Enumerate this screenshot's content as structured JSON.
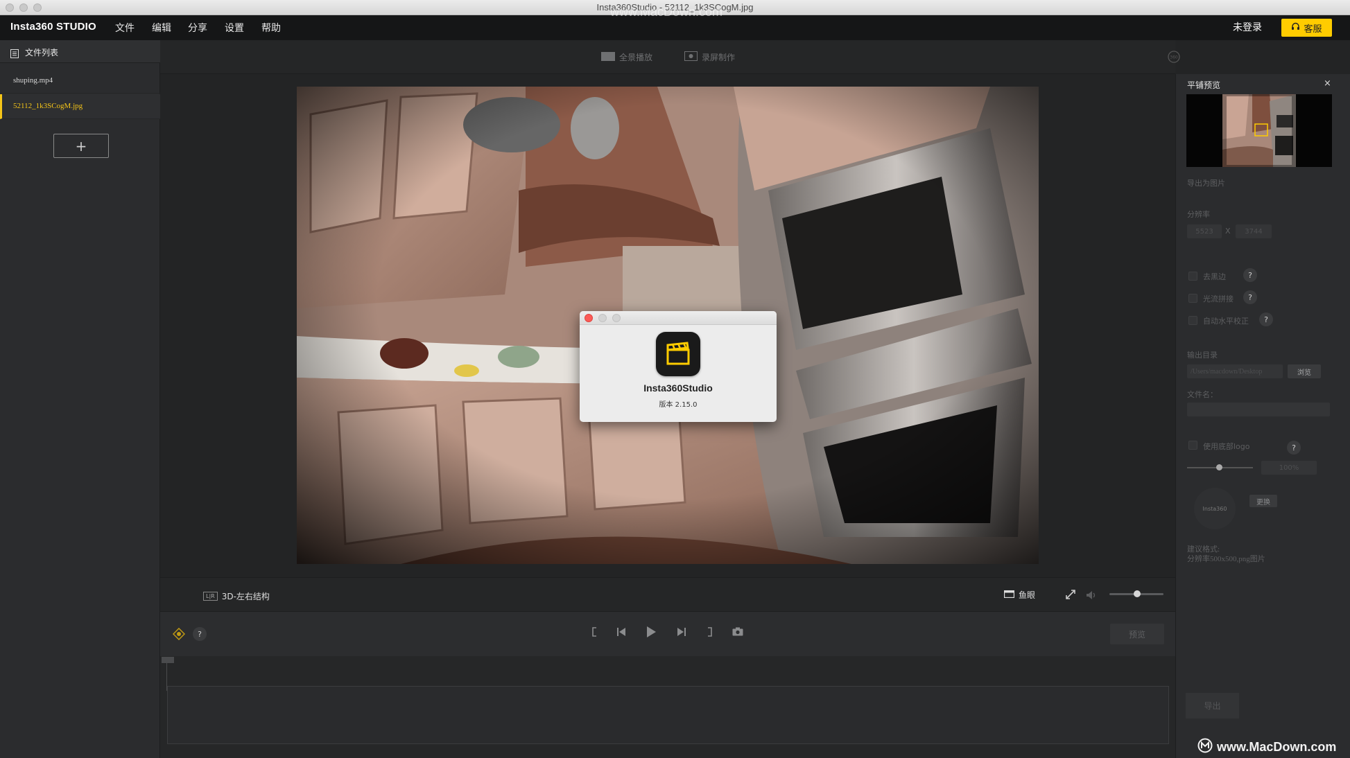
{
  "window": {
    "title": "Insta360Studio - 52112_1k3SCogM.jpg"
  },
  "watermark": "www.MacDown.com",
  "menubar": {
    "brand": "Insta360 STUDIO",
    "items": [
      "文件",
      "编辑",
      "分享",
      "设置",
      "帮助"
    ],
    "login": "未登录",
    "service_label": "客服"
  },
  "sidebar": {
    "title": "文件列表",
    "files": [
      {
        "name": "shuping.mp4",
        "active": false
      },
      {
        "name": "52112_1k3SCogM.jpg",
        "active": true
      }
    ],
    "add_label": "+"
  },
  "toolbar": {
    "fullscreen_play": "全景播放",
    "screen_record": "录屏制作"
  },
  "about": {
    "app_name": "Insta360Studio",
    "version": "版本 2.15.0"
  },
  "view_bar": {
    "mode_3d": "3D-左右结构",
    "mode_3d_badge": "L|R",
    "fisheye": "鱼眼"
  },
  "controls": {
    "help": "?",
    "preview_label": "预览"
  },
  "right_panel": {
    "title": "平铺预览",
    "close": "×",
    "export_as_image": "导出为图片",
    "resolution_label": "分辨率",
    "res_width": "5523",
    "res_x": "X",
    "res_height": "3744",
    "option_remove_black": "去黑边",
    "option_optical_stitch": "光流拼接",
    "option_auto_level": "自动水平校正",
    "output_dir_label": "输出目录",
    "output_dir_value": "/Users/macdown/Desktop",
    "browse_label": "浏览",
    "filename_label": "文件名：",
    "use_bottom_logo": "使用底部logo",
    "logo_opacity": "100%",
    "logo_text": "Insta360",
    "replace_label": "更换",
    "suggest_line1": "建议格式:",
    "suggest_line2": "分辨率500x500,png图片",
    "export_label": "导出",
    "help": "?"
  },
  "colors": {
    "accent": "#ffcc00",
    "active_file": "#f5c518",
    "background": "#232425"
  }
}
